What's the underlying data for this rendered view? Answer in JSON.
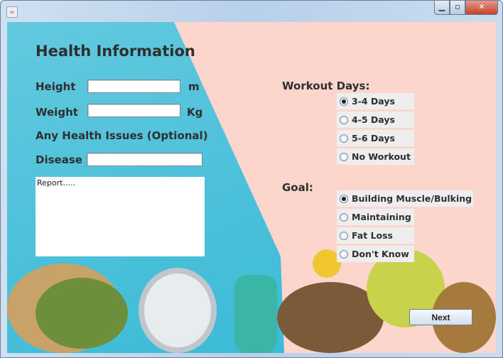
{
  "window": {
    "title": "",
    "icon": "java-icon",
    "minimize": "minimize-icon",
    "maximize": "maximize-icon",
    "close": "close-icon"
  },
  "form": {
    "title": "Health Information",
    "height_label": "Height",
    "height_unit": "m",
    "height_value": "",
    "weight_label": "Weight",
    "weight_unit": "Kg",
    "weight_value": "",
    "issues_label": "Any Health Issues (Optional)",
    "disease_label": "Disease",
    "disease_value": "",
    "report_value": "Report....."
  },
  "workout": {
    "label": "Workout Days:",
    "options": [
      "3-4 Days",
      "4-5 Days",
      "5-6 Days",
      "No Workout"
    ],
    "selected": "3-4 Days"
  },
  "goal": {
    "label": "Goal:",
    "options": [
      "Building Muscle/Bulking",
      "Maintaining",
      "Fat Loss",
      "Don't Know"
    ],
    "selected": "Building Muscle/Bulking"
  },
  "next_label": "Next"
}
